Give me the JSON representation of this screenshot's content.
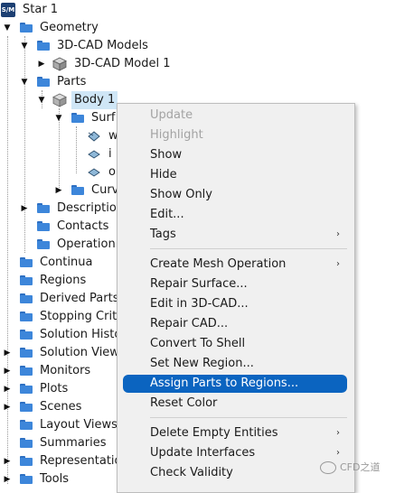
{
  "tree": {
    "root": "Star 1",
    "geometry": "Geometry",
    "cad_models": "3D-CAD Models",
    "cad_model_1": "3D-CAD Model 1",
    "parts": "Parts",
    "body1": "Body 1",
    "surfaces": "Surf",
    "surf_1": "w",
    "surf_2": "i",
    "surf_3": "o",
    "curves": "Curv",
    "descriptions": "Descriptio",
    "contacts": "Contacts",
    "operations": "Operation",
    "continua": "Continua",
    "regions": "Regions",
    "derived_parts": "Derived Parts",
    "stopping": "Stopping Crit",
    "solution_hist": "Solution Histo",
    "solution_view": "Solution View",
    "monitors": "Monitors",
    "plots": "Plots",
    "scenes": "Scenes",
    "layout_views": "Layout Views",
    "summaries": "Summaries",
    "representations": "Representatio",
    "tools": "Tools"
  },
  "menu": {
    "update": "Update",
    "highlight": "Highlight",
    "show": "Show",
    "hide": "Hide",
    "show_only": "Show Only",
    "edit": "Edit...",
    "tags": "Tags",
    "create_mesh_op": "Create Mesh Operation",
    "repair_surface": "Repair Surface...",
    "edit_in_cad": "Edit in 3D-CAD...",
    "repair_cad": "Repair CAD...",
    "convert_to_shell": "Convert To Shell",
    "set_new_region": "Set New Region...",
    "assign_parts": "Assign Parts to Regions...",
    "reset_color": "Reset Color",
    "delete_empty": "Delete Empty Entities",
    "update_interfaces": "Update Interfaces",
    "check_validity": "Check Validity",
    "submenu_arrow": "›"
  },
  "app_logo": "S/M",
  "watermark": "CFD之道",
  "colors": {
    "folder": "#3d86da",
    "selection": "#cfe6f6",
    "menu_highlight": "#0b64c0",
    "menu_bg": "#f0f0f0"
  }
}
